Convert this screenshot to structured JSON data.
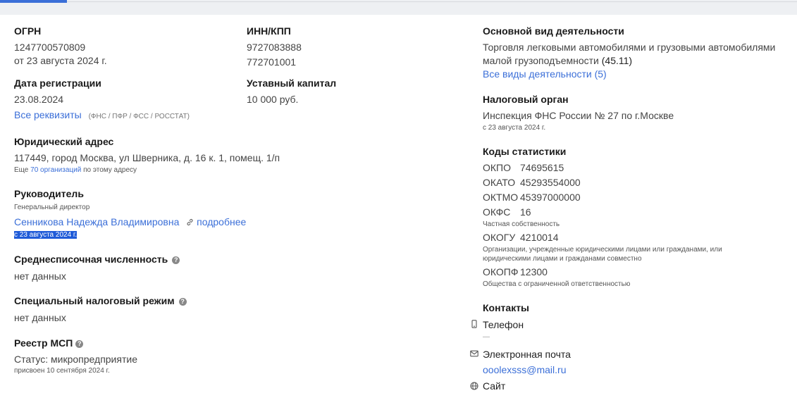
{
  "ogrn": {
    "title": "ОГРН",
    "value": "1247700570809",
    "date": "от 23 августа 2024 г."
  },
  "inn": {
    "title": "ИНН/КПП",
    "inn": "9727083888",
    "kpp": "772701001"
  },
  "reg": {
    "title": "Дата регистрации",
    "value": "23.08.2024",
    "link": "Все реквизиты",
    "note": "(ФНС / ПФР / ФСС / РОССТАТ)"
  },
  "capital": {
    "title": "Уставный капитал",
    "value": "10 000 руб."
  },
  "address": {
    "title": "Юридический адрес",
    "value": "117449, город Москва, ул Шверника, д. 16 к. 1, помещ. 1/п",
    "note_pre": "Еще",
    "note_link": "70 организаций",
    "note_post": "по этому адресу"
  },
  "head": {
    "title": "Руководитель",
    "role": "Генеральный директор",
    "name": "Сенникова Надежда Владимировна",
    "more": "подробнее",
    "since": "с 23 августа 2024 г."
  },
  "staff": {
    "title": "Среднесписочная численность",
    "value": "нет данных",
    "help": "?"
  },
  "tax_regime": {
    "title": "Специальный налоговый режим",
    "value": "нет данных",
    "help": "?"
  },
  "msp": {
    "title": "Реестр МСП",
    "status": "Статус: микропредприятие",
    "note": "присвоен 10 сентября 2024 г.",
    "help": "?"
  },
  "activity": {
    "title": "Основной вид деятельности",
    "line1": "Торговля легковыми автомобилями и грузовыми автомобилями",
    "line2": "малой грузоподъемности",
    "code": "(45.11)",
    "link": "Все виды деятельности (5)"
  },
  "tax_office": {
    "title": "Налоговый орган",
    "value": "Инспекция ФНС России № 27 по г.Москве",
    "since": "с 23 августа 2024 г."
  },
  "codes": {
    "title": "Коды статистики",
    "okpo": {
      "label": "ОКПО",
      "value": "74695615"
    },
    "okato": {
      "label": "ОКАТО",
      "value": "45293554000"
    },
    "oktmo": {
      "label": "ОКТМО",
      "value": "45397000000"
    },
    "okfs": {
      "label": "ОКФС",
      "value": "16",
      "note": "Частная собственность"
    },
    "okogu": {
      "label": "ОКОГУ",
      "value": "4210014",
      "note1": "Организации, учрежденные юридическими лицами или гражданами, или",
      "note2": "юридическими лицами и гражданами совместно"
    },
    "okopf": {
      "label": "ОКОПФ",
      "value": "12300",
      "note": "Общества с ограниченной ответственностью"
    }
  },
  "contacts": {
    "title": "Контакты",
    "phone_label": "Телефон",
    "phone_value": "—",
    "email_label": "Электронная почта",
    "email_value": "ooolexsss@mail.ru",
    "site_label": "Сайт"
  }
}
